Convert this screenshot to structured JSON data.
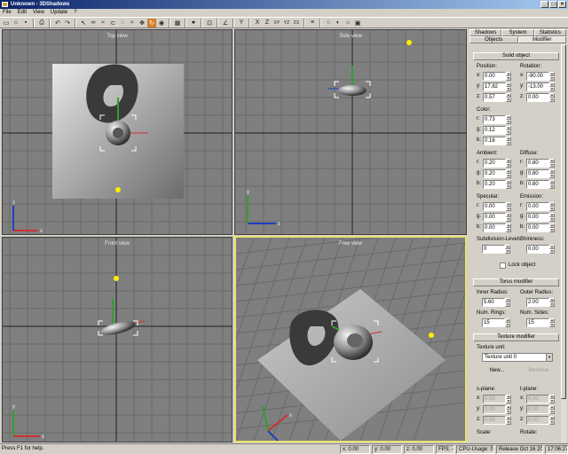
{
  "window": {
    "title": "Unknown - 3DShadows",
    "btn_min": "_",
    "btn_max": "□",
    "btn_close": "×"
  },
  "menu": [
    "File",
    "Edit",
    "View",
    "Update",
    "?"
  ],
  "toolbar": {
    "icons": [
      "new-icon",
      "open-icon",
      "save-icon",
      "sep",
      "print-icon",
      "sep",
      "undo-icon",
      "redo-icon",
      "sep",
      "select-arrow-icon",
      "link-icon",
      "unlink-icon",
      "bind-icon",
      "lasso-icon",
      "zoom-icon",
      "move-icon",
      "rotate-icon",
      "scale-icon",
      "sep",
      "grid-icon",
      "sep",
      "sphere-icon",
      "sep",
      "snap-icon",
      "sep",
      "angle-snap-icon",
      "sep",
      "y-axis-icon",
      "sep",
      "x-axis-icon",
      "z-axis-icon",
      "xy-plane-icon",
      "yz-plane-icon",
      "zx-plane-icon",
      "sep",
      "layers-icon",
      "sep",
      "timer-icon",
      "render-icon",
      "light-icon",
      "camera-icon"
    ],
    "labels": {
      "y_axis": "Y",
      "xy": "XY",
      "yz": "YZ",
      "zx": "ZX",
      "x": "X",
      "z": "Z"
    }
  },
  "viewports": {
    "top": "Top view",
    "side": "Side view",
    "front": "Front view",
    "free": "Free view"
  },
  "axes": {
    "x": "x",
    "y": "y",
    "z": "z"
  },
  "panel": {
    "tabs_row1": [
      "Shadows",
      "System",
      "Statistics"
    ],
    "tabs_row2": [
      "Objects",
      "Modifier"
    ],
    "solid_object": {
      "header": "Solid object",
      "position_label": "Position:",
      "rotation_label": "Rotation:",
      "position": {
        "x": "0.00",
        "y": "17.82",
        "z": "0.57"
      },
      "rotation": {
        "x": "-90.00",
        "y": "-13.00",
        "z": "0.00"
      },
      "color_label": "Color:",
      "color": {
        "r": "0.73",
        "g": "0.12",
        "b": "0.16"
      },
      "ambient_label": "Ambient:",
      "ambient": {
        "r": "0.20",
        "g": "0.20",
        "b": "0.20"
      },
      "diffuse_label": "Diffuse:",
      "diffuse": {
        "r": "0.80",
        "g": "0.80",
        "b": "0.80"
      },
      "specular_label": "Specular:",
      "specular": {
        "r": "0.00",
        "g": "0.00",
        "b": "0.00"
      },
      "emission_label": "Emission:",
      "emission": {
        "r": "0.00",
        "g": "0.00",
        "b": "0.00"
      },
      "subdivision_label": "Subdivision-Levels:",
      "subdivision": "0",
      "shininess_label": "Shininess:",
      "shininess": "0.00",
      "lock_label": "Lock object"
    },
    "torus_modifier": {
      "header": "Torus modifier",
      "inner_label": "Inner Radius:",
      "inner": "5.60",
      "outer_label": "Outer Radius:",
      "outer": "2.00",
      "rings_label": "Num. Rings:",
      "rings": "15",
      "sides_label": "Num. Sides:",
      "sides": "15"
    },
    "texture_modifier": {
      "header": "Texture modifier",
      "unit_label": "Texture unit:",
      "unit": "Texture unit 0",
      "new_btn": "New...",
      "remove_btn": "Remove",
      "splane_label": "s-plane:",
      "tplane_label": "t-plane:",
      "s": {
        "x": "0.00",
        "y": "0.00",
        "z": "0.00"
      },
      "t": {
        "x": "0.00",
        "y": "0.00",
        "z": "0.00"
      },
      "scale_label": "Scale:",
      "rotate_label": "Rotate:"
    },
    "letters": {
      "x": "x:",
      "y": "y:",
      "z": "z:",
      "r": "r:",
      "g": "g:",
      "b": "b:"
    }
  },
  "status": {
    "help": "Press F1 for help.",
    "x": "x: 0.00",
    "y": "y: 0.00",
    "z": "z: 0.00",
    "fps": "FPS: -",
    "cpu": "CPU-Usage: 0 %",
    "release": "Release Oct 16 2002",
    "time": "17:06:27"
  },
  "colors": {
    "viewport_bg": "#7f7f7f",
    "grid": "#6a6a6a",
    "active_border": "#e8e070",
    "light": "#ffef00",
    "title_start": "#0a246a",
    "title_end": "#a6caf0"
  }
}
